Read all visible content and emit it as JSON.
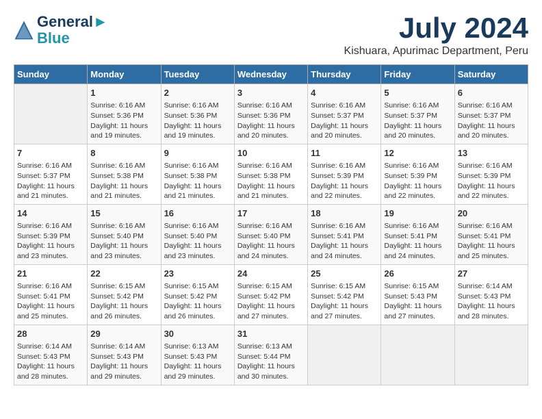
{
  "logo": {
    "line1": "General",
    "line2": "Blue"
  },
  "title": "July 2024",
  "location": "Kishuara, Apurimac Department, Peru",
  "weekdays": [
    "Sunday",
    "Monday",
    "Tuesday",
    "Wednesday",
    "Thursday",
    "Friday",
    "Saturday"
  ],
  "weeks": [
    [
      {
        "day": "",
        "info": ""
      },
      {
        "day": "1",
        "info": "Sunrise: 6:16 AM\nSunset: 5:36 PM\nDaylight: 11 hours\nand 19 minutes."
      },
      {
        "day": "2",
        "info": "Sunrise: 6:16 AM\nSunset: 5:36 PM\nDaylight: 11 hours\nand 19 minutes."
      },
      {
        "day": "3",
        "info": "Sunrise: 6:16 AM\nSunset: 5:36 PM\nDaylight: 11 hours\nand 20 minutes."
      },
      {
        "day": "4",
        "info": "Sunrise: 6:16 AM\nSunset: 5:37 PM\nDaylight: 11 hours\nand 20 minutes."
      },
      {
        "day": "5",
        "info": "Sunrise: 6:16 AM\nSunset: 5:37 PM\nDaylight: 11 hours\nand 20 minutes."
      },
      {
        "day": "6",
        "info": "Sunrise: 6:16 AM\nSunset: 5:37 PM\nDaylight: 11 hours\nand 20 minutes."
      }
    ],
    [
      {
        "day": "7",
        "info": "Sunrise: 6:16 AM\nSunset: 5:37 PM\nDaylight: 11 hours\nand 21 minutes."
      },
      {
        "day": "8",
        "info": "Sunrise: 6:16 AM\nSunset: 5:38 PM\nDaylight: 11 hours\nand 21 minutes."
      },
      {
        "day": "9",
        "info": "Sunrise: 6:16 AM\nSunset: 5:38 PM\nDaylight: 11 hours\nand 21 minutes."
      },
      {
        "day": "10",
        "info": "Sunrise: 6:16 AM\nSunset: 5:38 PM\nDaylight: 11 hours\nand 21 minutes."
      },
      {
        "day": "11",
        "info": "Sunrise: 6:16 AM\nSunset: 5:39 PM\nDaylight: 11 hours\nand 22 minutes."
      },
      {
        "day": "12",
        "info": "Sunrise: 6:16 AM\nSunset: 5:39 PM\nDaylight: 11 hours\nand 22 minutes."
      },
      {
        "day": "13",
        "info": "Sunrise: 6:16 AM\nSunset: 5:39 PM\nDaylight: 11 hours\nand 22 minutes."
      }
    ],
    [
      {
        "day": "14",
        "info": "Sunrise: 6:16 AM\nSunset: 5:39 PM\nDaylight: 11 hours\nand 23 minutes."
      },
      {
        "day": "15",
        "info": "Sunrise: 6:16 AM\nSunset: 5:40 PM\nDaylight: 11 hours\nand 23 minutes."
      },
      {
        "day": "16",
        "info": "Sunrise: 6:16 AM\nSunset: 5:40 PM\nDaylight: 11 hours\nand 23 minutes."
      },
      {
        "day": "17",
        "info": "Sunrise: 6:16 AM\nSunset: 5:40 PM\nDaylight: 11 hours\nand 24 minutes."
      },
      {
        "day": "18",
        "info": "Sunrise: 6:16 AM\nSunset: 5:41 PM\nDaylight: 11 hours\nand 24 minutes."
      },
      {
        "day": "19",
        "info": "Sunrise: 6:16 AM\nSunset: 5:41 PM\nDaylight: 11 hours\nand 24 minutes."
      },
      {
        "day": "20",
        "info": "Sunrise: 6:16 AM\nSunset: 5:41 PM\nDaylight: 11 hours\nand 25 minutes."
      }
    ],
    [
      {
        "day": "21",
        "info": "Sunrise: 6:16 AM\nSunset: 5:41 PM\nDaylight: 11 hours\nand 25 minutes."
      },
      {
        "day": "22",
        "info": "Sunrise: 6:15 AM\nSunset: 5:42 PM\nDaylight: 11 hours\nand 26 minutes."
      },
      {
        "day": "23",
        "info": "Sunrise: 6:15 AM\nSunset: 5:42 PM\nDaylight: 11 hours\nand 26 minutes."
      },
      {
        "day": "24",
        "info": "Sunrise: 6:15 AM\nSunset: 5:42 PM\nDaylight: 11 hours\nand 27 minutes."
      },
      {
        "day": "25",
        "info": "Sunrise: 6:15 AM\nSunset: 5:42 PM\nDaylight: 11 hours\nand 27 minutes."
      },
      {
        "day": "26",
        "info": "Sunrise: 6:15 AM\nSunset: 5:43 PM\nDaylight: 11 hours\nand 27 minutes."
      },
      {
        "day": "27",
        "info": "Sunrise: 6:14 AM\nSunset: 5:43 PM\nDaylight: 11 hours\nand 28 minutes."
      }
    ],
    [
      {
        "day": "28",
        "info": "Sunrise: 6:14 AM\nSunset: 5:43 PM\nDaylight: 11 hours\nand 28 minutes."
      },
      {
        "day": "29",
        "info": "Sunrise: 6:14 AM\nSunset: 5:43 PM\nDaylight: 11 hours\nand 29 minutes."
      },
      {
        "day": "30",
        "info": "Sunrise: 6:13 AM\nSunset: 5:43 PM\nDaylight: 11 hours\nand 29 minutes."
      },
      {
        "day": "31",
        "info": "Sunrise: 6:13 AM\nSunset: 5:44 PM\nDaylight: 11 hours\nand 30 minutes."
      },
      {
        "day": "",
        "info": ""
      },
      {
        "day": "",
        "info": ""
      },
      {
        "day": "",
        "info": ""
      }
    ]
  ]
}
